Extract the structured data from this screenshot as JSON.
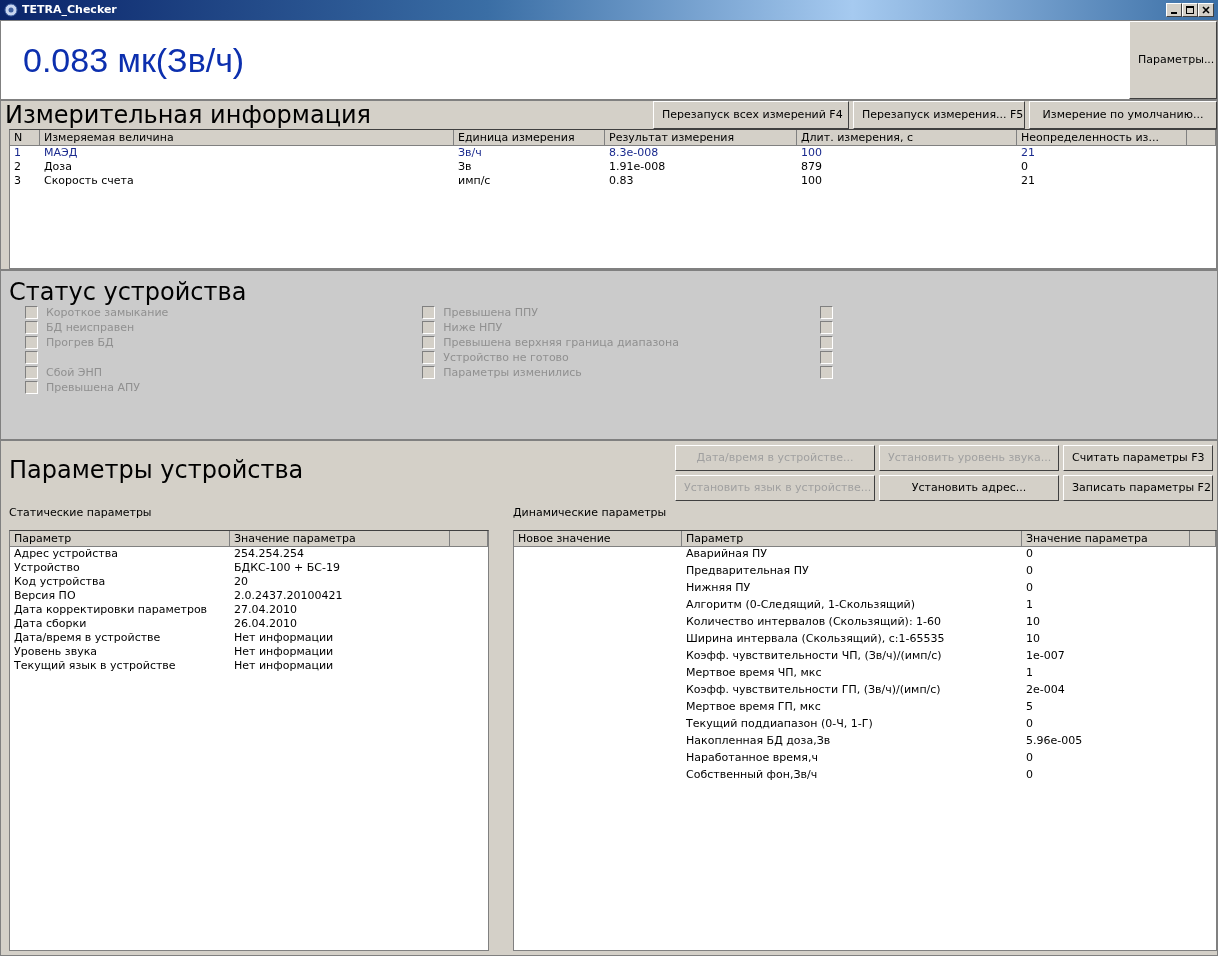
{
  "window": {
    "title": "TETRA_Checker"
  },
  "readout": {
    "value": "0.083 мк(Зв/ч)",
    "button": "Параметры..."
  },
  "measurements": {
    "title": "Измерительная информация",
    "buttons": [
      {
        "label": "Перезапуск всех измерений  F4",
        "disabled": false
      },
      {
        "label": "Перезапуск измерения...  F5",
        "disabled": false
      },
      {
        "label": "Измерение по умолчанию...",
        "disabled": false
      }
    ],
    "columns": [
      "N",
      "Измеряемая величина",
      "Единица измерения",
      "Результат измерения",
      "Длит. измерения, с",
      "Неопределенность из..."
    ],
    "rows": [
      {
        "selected": true,
        "cells": [
          "1",
          "МАЭД",
          "Зв/ч",
          "8.3e-008",
          "100",
          "21"
        ]
      },
      {
        "selected": false,
        "cells": [
          "2",
          "Доза",
          "Зв",
          "1.91e-008",
          "879",
          "0"
        ]
      },
      {
        "selected": false,
        "cells": [
          "3",
          "Скорость счета",
          "имп/с",
          "0.83",
          "100",
          "21"
        ]
      }
    ]
  },
  "status": {
    "title": "Статус устройства",
    "columns": [
      [
        {
          "label": "Короткое замыкание",
          "checked": false,
          "disabled": true
        },
        {
          "label": "БД неисправен",
          "checked": false,
          "disabled": true
        },
        {
          "label": "Прогрев БД",
          "checked": false,
          "disabled": true
        },
        {
          "checked": false,
          "disabled": true
        },
        {
          "label": "Сбой ЭНП",
          "checked": false,
          "disabled": true
        },
        {
          "label": "Превышена АПУ",
          "checked": false,
          "disabled": true
        }
      ],
      [
        {
          "label": "Превышена ППУ",
          "checked": false,
          "disabled": true
        },
        {
          "label": "Ниже НПУ",
          "checked": false,
          "disabled": true
        },
        {
          "label": "Превышена верхняя граница диапазона",
          "checked": false,
          "disabled": true
        },
        {
          "label": "Устройство не готово",
          "checked": false,
          "disabled": true
        },
        {
          "label": "Параметры изменились",
          "checked": false,
          "disabled": true
        }
      ],
      [
        {
          "checked": false,
          "disabled": true
        },
        {
          "checked": false,
          "disabled": true
        },
        {
          "checked": false,
          "disabled": true
        },
        {
          "checked": false,
          "disabled": true
        },
        {
          "checked": false,
          "disabled": true
        }
      ]
    ]
  },
  "parameters": {
    "title": "Параметры устройства",
    "buttons": [
      [
        {
          "label": "Дата/время в устройстве...",
          "disabled": true
        },
        {
          "label": "Установить уровень звука...",
          "disabled": true
        },
        {
          "label": "Считать параметры  F3",
          "disabled": false
        }
      ],
      [
        {
          "label": "Установить язык в устройстве...",
          "disabled": true
        },
        {
          "label": "Установить адрес...",
          "disabled": false
        },
        {
          "label": "Записать параметры  F2",
          "disabled": false
        }
      ]
    ],
    "static": {
      "title": "Статические параметры",
      "columns": [
        "Параметр",
        "Значение параметра"
      ],
      "rows": [
        [
          "Адрес устройства",
          "254.254.254"
        ],
        [
          "Устройство",
          "БДКС-100 + БС-19"
        ],
        [
          "Код устройства",
          "20"
        ],
        [
          "Версия ПО",
          "2.0.2437.20100421"
        ],
        [
          "Дата корректировки параметров",
          "27.04.2010"
        ],
        [
          "Дата сборки",
          "26.04.2010"
        ],
        [
          "Дата/время в устройстве",
          "Нет информации"
        ],
        [
          "Уровень звука",
          "Нет информации"
        ],
        [
          "Текущий язык в устройстве",
          "Нет информации"
        ]
      ]
    },
    "dynamic": {
      "title": "Динамические параметры",
      "columns": [
        "Новое значение",
        "Параметр",
        "Значение параметра"
      ],
      "rows": [
        [
          "",
          "Аварийная ПУ",
          "0"
        ],
        [
          "",
          "Предварительная ПУ",
          "0"
        ],
        [
          "",
          "Нижняя ПУ",
          "0"
        ],
        [
          "",
          "Алгоритм (0-Следящий, 1-Скользящий)",
          "1"
        ],
        [
          "",
          "Количество интервалов (Скользящий): 1-60",
          "10"
        ],
        [
          "",
          "Ширина интервала (Скользящий), с:1-65535",
          "10"
        ],
        [
          "",
          "Коэфф. чувствительности ЧП, (Зв/ч)/(имп/с)",
          "1e-007"
        ],
        [
          "",
          "Мертвое время ЧП, мкс",
          "1"
        ],
        [
          "",
          "Коэфф. чувствительности ГП, (Зв/ч)/(имп/с)",
          "2e-004"
        ],
        [
          "",
          "Мертвое время ГП, мкс",
          "5"
        ],
        [
          "",
          "Текущий поддиапазон (0-Ч, 1-Г)",
          "0"
        ],
        [
          "",
          "Накопленная БД доза,Зв",
          "5.96e-005"
        ],
        [
          "",
          "Наработанное время,ч",
          "0"
        ],
        [
          "",
          "Собственный фон,Зв/ч",
          "0"
        ]
      ]
    }
  }
}
